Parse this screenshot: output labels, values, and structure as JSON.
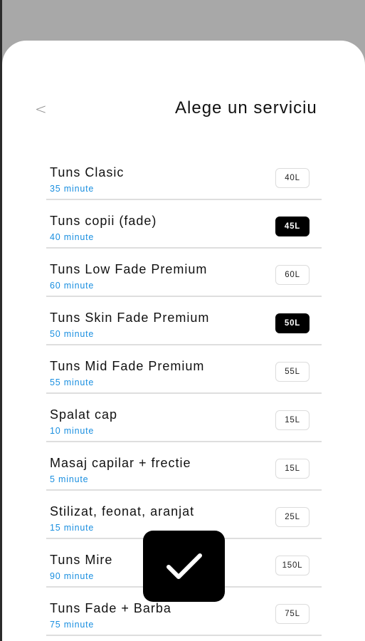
{
  "header": {
    "back_label": "<",
    "title": "Alege un serviciu"
  },
  "services": [
    {
      "name": "Tuns Clasic",
      "duration": "35 minute",
      "price": "40L",
      "selected": false
    },
    {
      "name": "Tuns copii (fade)",
      "duration": "40 minute",
      "price": "45L",
      "selected": true
    },
    {
      "name": "Tuns Low Fade Premium",
      "duration": "60 minute",
      "price": "60L",
      "selected": false
    },
    {
      "name": "Tuns Skin Fade Premium",
      "duration": "50 minute",
      "price": "50L",
      "selected": true
    },
    {
      "name": "Tuns Mid Fade Premium",
      "duration": "55 minute",
      "price": "55L",
      "selected": false
    },
    {
      "name": "Spalat cap",
      "duration": "10 minute",
      "price": "15L",
      "selected": false
    },
    {
      "name": "Masaj capilar + frectie",
      "duration": "5 minute",
      "price": "15L",
      "selected": false
    },
    {
      "name": "Stilizat, feonat, aranjat",
      "duration": "15 minute",
      "price": "25L",
      "selected": false
    },
    {
      "name": "Tuns Mire",
      "duration": "90 minute",
      "price": "150L",
      "selected": false
    },
    {
      "name": "Tuns Fade + Barba",
      "duration": "75 minute",
      "price": "75L",
      "selected": false
    }
  ],
  "confirm_button": {
    "icon": "checkmark-icon"
  },
  "colors": {
    "accent_duration": "#1a8fe0",
    "selected_price_bg": "#000000",
    "overlay": "#a8a8a8"
  }
}
